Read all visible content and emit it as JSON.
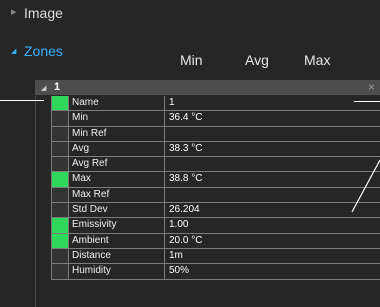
{
  "sections": {
    "image": {
      "label": "Image"
    },
    "zones": {
      "label": "Zones"
    }
  },
  "columns": {
    "min": "Min",
    "avg": "Avg",
    "max": "Max"
  },
  "zone": {
    "number": "1",
    "close_glyph": "×",
    "rows": [
      {
        "name": "Name",
        "value": "1",
        "swatch": true
      },
      {
        "name": "Min",
        "value": "36.4 °C",
        "swatch": false
      },
      {
        "name": "Min Ref",
        "value": "",
        "swatch": false
      },
      {
        "name": "Avg",
        "value": "38.3 °C",
        "swatch": false
      },
      {
        "name": "Avg Ref",
        "value": "",
        "swatch": false
      },
      {
        "name": "Max",
        "value": "38.8 °C",
        "swatch": true
      },
      {
        "name": "Max Ref",
        "value": "",
        "swatch": false
      },
      {
        "name": "Std Dev",
        "value": "26.204",
        "swatch": false
      },
      {
        "name": "Emissivity",
        "value": "1.00",
        "swatch": true
      },
      {
        "name": "Ambient",
        "value": "20.0 °C",
        "swatch": true
      },
      {
        "name": "Distance",
        "value": "1m",
        "swatch": false
      },
      {
        "name": "Humidity",
        "value": "50%",
        "swatch": false
      }
    ]
  },
  "colors": {
    "accent": "#36b0ff",
    "swatch_on": "#2fd85a",
    "background": "#262626",
    "header_bar": "#4d4d4d"
  }
}
